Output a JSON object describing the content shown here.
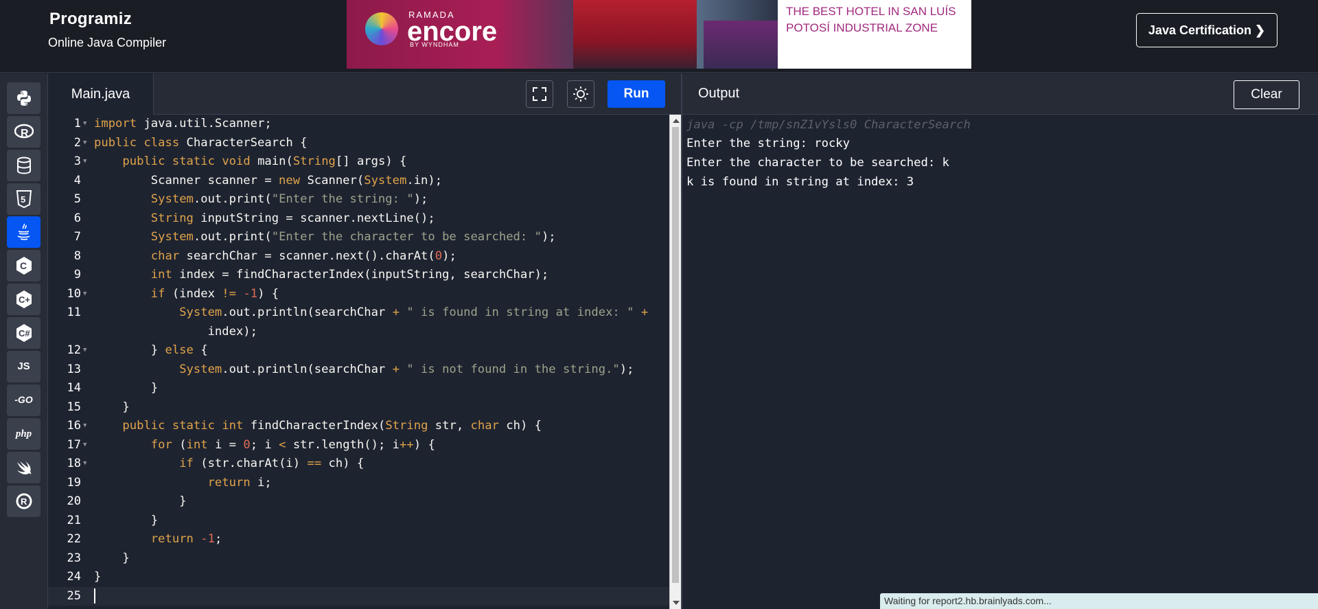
{
  "header": {
    "logo": "Programiz",
    "subtitle": "Online Java Compiler",
    "certification_button": "Java Certification ❯"
  },
  "ad": {
    "brand_top": "RAMADA",
    "brand_name": "encore",
    "brand_sub": "BY WYNDHAM",
    "tagline": "THE BEST HOTEL IN SAN LUÍS POTOSÍ INDUSTRIAL ZONE"
  },
  "sidebar": {
    "languages": [
      {
        "name": "python-icon",
        "label": ""
      },
      {
        "name": "r-icon",
        "label": "R"
      },
      {
        "name": "sql-icon",
        "label": ""
      },
      {
        "name": "html5-icon",
        "label": "5"
      },
      {
        "name": "java-icon",
        "label": "",
        "active": true
      },
      {
        "name": "c-icon",
        "label": "C"
      },
      {
        "name": "cpp-icon",
        "label": "C"
      },
      {
        "name": "csharp-icon",
        "label": "C"
      },
      {
        "name": "js-icon",
        "label": "JS"
      },
      {
        "name": "go-icon",
        "label": "GO"
      },
      {
        "name": "php-icon",
        "label": "php"
      },
      {
        "name": "swift-icon",
        "label": ""
      },
      {
        "name": "rust-icon",
        "label": "R"
      }
    ]
  },
  "editor": {
    "file_tab": "Main.java",
    "run_label": "Run",
    "code_lines": [
      {
        "num": "1",
        "text": "import java.util.Scanner;"
      },
      {
        "num": "2",
        "text": "public class CharacterSearch {"
      },
      {
        "num": "3",
        "text": "    public static void main(String[] args) {"
      },
      {
        "num": "4",
        "text": "        Scanner scanner = new Scanner(System.in);"
      },
      {
        "num": "5",
        "text": "        System.out.print(\"Enter the string: \");"
      },
      {
        "num": "6",
        "text": "        String inputString = scanner.nextLine();"
      },
      {
        "num": "7",
        "text": "        System.out.print(\"Enter the character to be searched: \");"
      },
      {
        "num": "8",
        "text": "        char searchChar = scanner.next().charAt(0);"
      },
      {
        "num": "9",
        "text": "        int index = findCharacterIndex(inputString, searchChar);"
      },
      {
        "num": "10",
        "text": "        if (index != -1) {"
      },
      {
        "num": "11",
        "text": "            System.out.println(searchChar + \" is found in string at index: \" +"
      },
      {
        "num": "",
        "text": "                index);"
      },
      {
        "num": "12",
        "text": "        } else {"
      },
      {
        "num": "13",
        "text": "            System.out.println(searchChar + \" is not found in the string.\");"
      },
      {
        "num": "14",
        "text": "        }"
      },
      {
        "num": "15",
        "text": "    }"
      },
      {
        "num": "16",
        "text": "    public static int findCharacterIndex(String str, char ch) {"
      },
      {
        "num": "17",
        "text": "        for (int i = 0; i < str.length(); i++) {"
      },
      {
        "num": "18",
        "text": "            if (str.charAt(i) == ch) {"
      },
      {
        "num": "19",
        "text": "                return i;"
      },
      {
        "num": "20",
        "text": "            }"
      },
      {
        "num": "21",
        "text": "        }"
      },
      {
        "num": "22",
        "text": "        return -1;"
      },
      {
        "num": "23",
        "text": "    }"
      },
      {
        "num": "24",
        "text": "}"
      },
      {
        "num": "25",
        "text": ""
      }
    ]
  },
  "output": {
    "title": "Output",
    "clear_label": "Clear",
    "command": "java -cp /tmp/snZ1vYsls0 CharacterSearch",
    "lines": [
      "Enter the string: rocky",
      "Enter the character to be searched: k",
      "k is found in string at index: 3"
    ]
  },
  "status": "Waiting for report2.hb.brainlyads.com..."
}
